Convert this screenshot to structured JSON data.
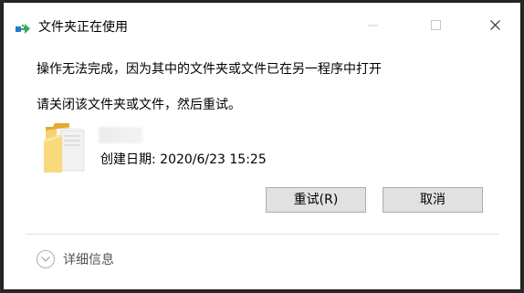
{
  "window": {
    "title": "文件夹正在使用",
    "minimize_icon": "minimize-icon",
    "maximize_icon": "maximize-icon",
    "close_icon": "close-icon"
  },
  "message": {
    "main": "操作无法完成，因为其中的文件夹或文件已在另一程序中打开",
    "sub": "请关闭该文件夹或文件，然后重试。"
  },
  "file": {
    "icon": "folder-icon",
    "created": "创建日期: 2020/6/23 15:25"
  },
  "buttons": {
    "retry": "重试(R)",
    "cancel": "取消"
  },
  "details": {
    "label": "详细信息",
    "icon": "chevron-down-icon"
  },
  "colors": {
    "folder": "#f4c542",
    "button_bg": "#e1e1e1",
    "button_border": "#adadad"
  }
}
